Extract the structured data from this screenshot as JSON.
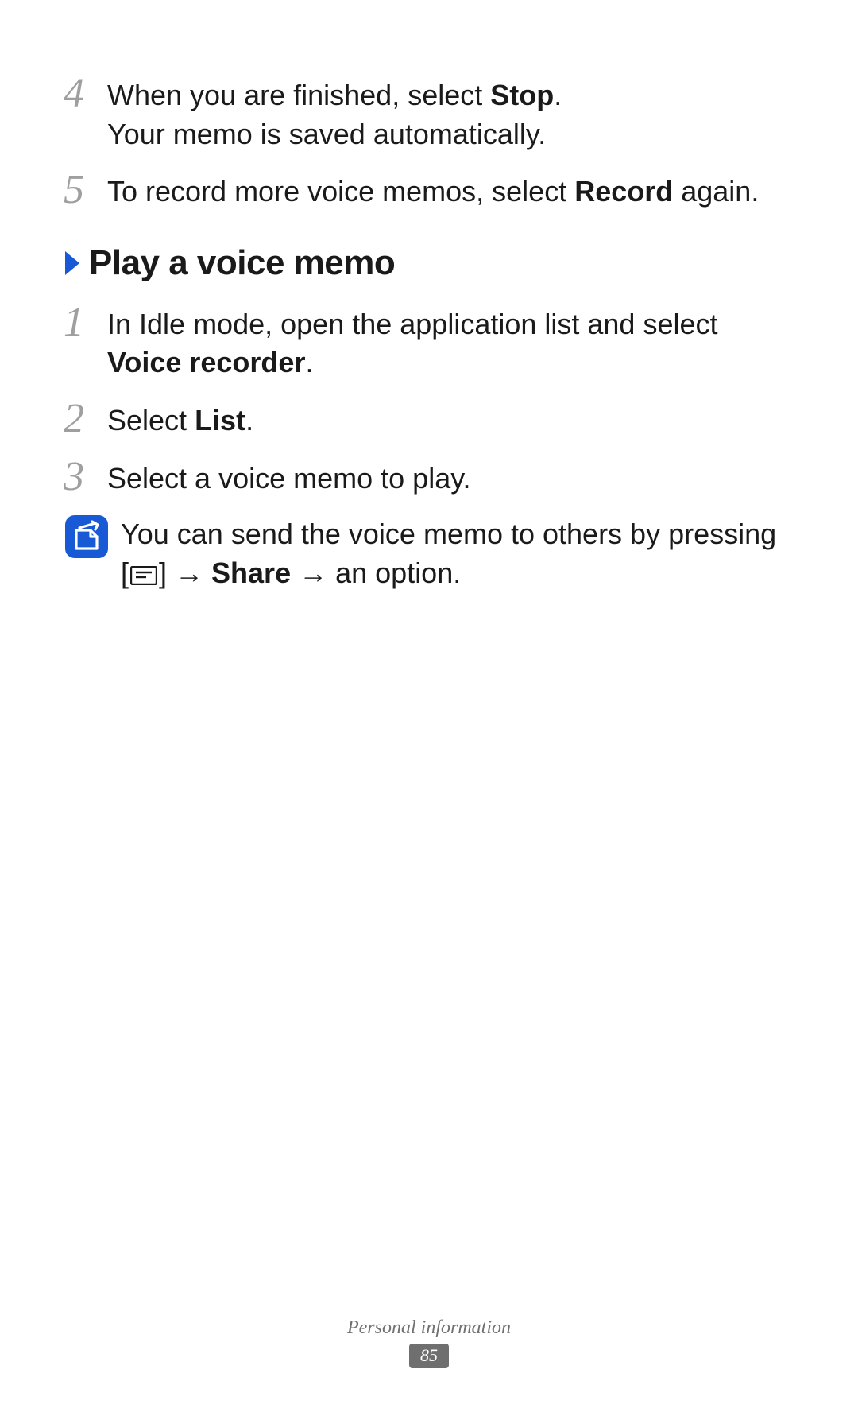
{
  "topSteps": [
    {
      "num": "4",
      "lines": [
        [
          {
            "t": "When you are finished, select "
          },
          {
            "t": "Stop",
            "bold": true
          },
          {
            "t": "."
          }
        ],
        [
          {
            "t": "Your memo is saved automatically."
          }
        ]
      ]
    },
    {
      "num": "5",
      "lines": [
        [
          {
            "t": "To record more voice memos, select "
          },
          {
            "t": "Record",
            "bold": true
          },
          {
            "t": " again."
          }
        ]
      ]
    }
  ],
  "section": {
    "title": "Play a voice memo",
    "steps": [
      {
        "num": "1",
        "lines": [
          [
            {
              "t": "In Idle mode, open the application list and select "
            },
            {
              "t": "Voice recorder",
              "bold": true
            },
            {
              "t": "."
            }
          ]
        ]
      },
      {
        "num": "2",
        "lines": [
          [
            {
              "t": "Select "
            },
            {
              "t": "List",
              "bold": true
            },
            {
              "t": "."
            }
          ]
        ]
      },
      {
        "num": "3",
        "lines": [
          [
            {
              "t": "Select a voice memo to play."
            }
          ]
        ]
      }
    ],
    "note": {
      "lines": [
        [
          {
            "t": "You can send the voice memo to others by pressing"
          }
        ],
        [
          {
            "t": "["
          },
          {
            "icon": "menu"
          },
          {
            "t": "] → "
          },
          {
            "t": "Share",
            "bold": true
          },
          {
            "t": " → an option."
          }
        ]
      ]
    }
  },
  "footer": {
    "label": "Personal information",
    "page": "85"
  }
}
